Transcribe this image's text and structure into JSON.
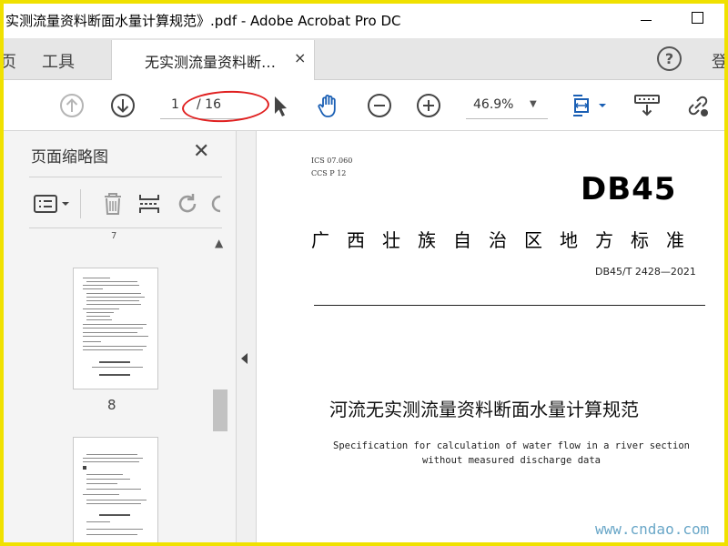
{
  "window": {
    "title": "实测流量资料断面水量计算规范》.pdf - Adobe Acrobat Pro DC"
  },
  "tabs": {
    "home_label": "页",
    "tools_label": "工具",
    "document_label": "无实测流量资料断…",
    "close_symbol": "×",
    "help_symbol": "?",
    "login_label": "登"
  },
  "toolbar": {
    "page_current": "1",
    "page_total": "/ 16",
    "zoom_value": "46.9%",
    "icons": [
      "prev-page-icon",
      "next-page-icon",
      "select-cursor-icon",
      "hand-tool-icon",
      "zoom-out-icon",
      "zoom-in-icon",
      "fit-page-icon",
      "scroll-mode-icon",
      "link-icon"
    ],
    "accent_color": "#1a5fb4"
  },
  "sidebar": {
    "title": "页面缩略图",
    "close_symbol": "✕",
    "top_partial_label": "7",
    "thumbnails": [
      {
        "label": "8"
      },
      {
        "label": ""
      }
    ],
    "tools": [
      "thumbnail-options-icon",
      "delete-page-icon",
      "insert-page-icon",
      "rotate-page-icon"
    ]
  },
  "document": {
    "ics": "ICS  07.060",
    "ccs": "CCS  P  12",
    "code": "DB45",
    "standard_title": "广西壮族自治区地方标准",
    "standard_no": "DB45/T  2428—2021",
    "cn_title": "河流无实测流量资料断面水量计算规范",
    "en_title": "Specification for calculation of water flow in a river section without measured discharge data"
  },
  "watermark": "www.cndao.com",
  "annotation_color": "#e02020"
}
